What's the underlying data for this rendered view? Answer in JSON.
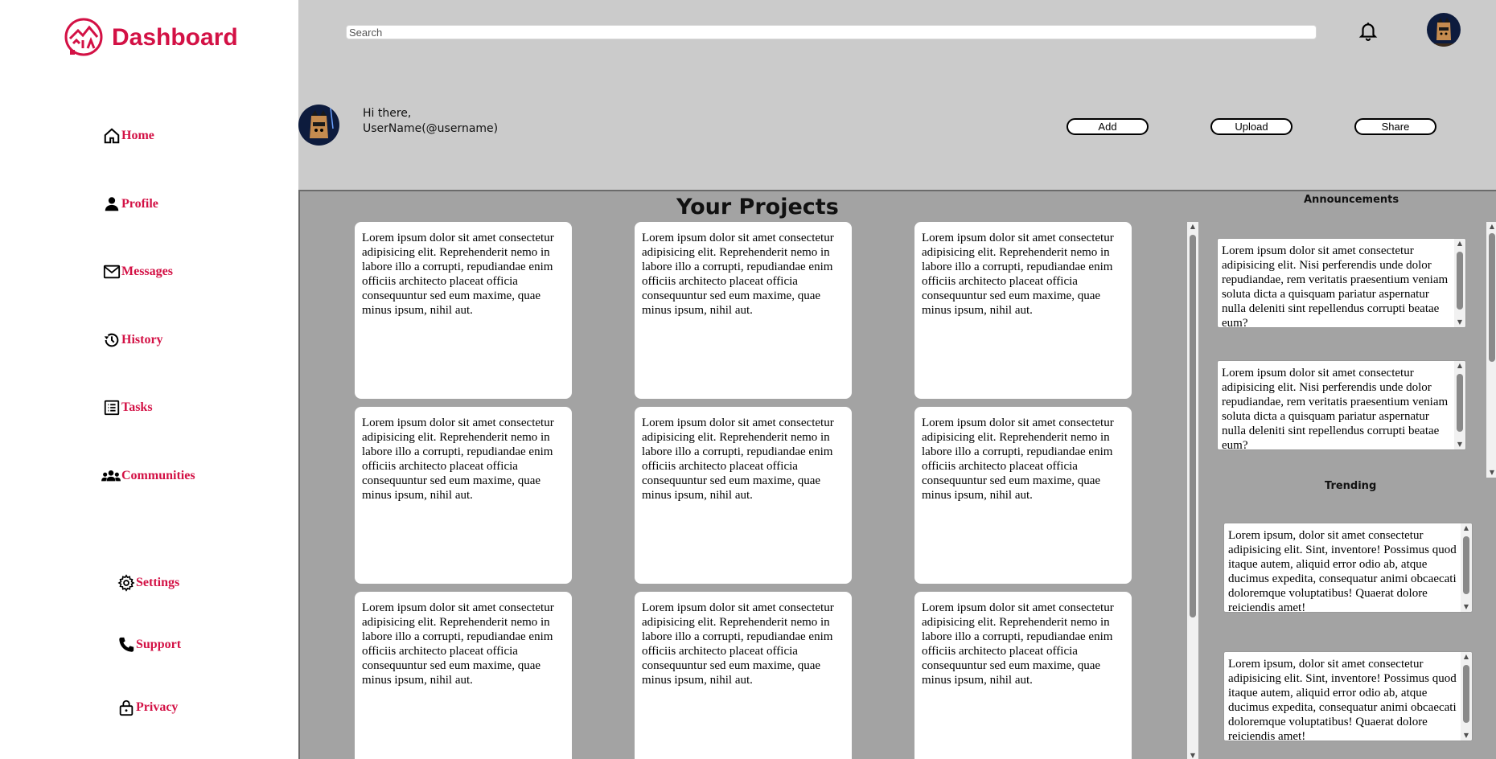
{
  "brand": {
    "title": "Dashboard",
    "color": "#d31145",
    "logo_icon": "aia-logo"
  },
  "sidebar": {
    "items": [
      {
        "label": "Home",
        "icon": "home-icon"
      },
      {
        "label": "Profile",
        "icon": "person-icon"
      },
      {
        "label": "Messages",
        "icon": "mail-icon"
      },
      {
        "label": "History",
        "icon": "history-icon"
      },
      {
        "label": "Tasks",
        "icon": "tasks-icon"
      },
      {
        "label": "Communities",
        "icon": "group-icon"
      }
    ],
    "bottom_items": [
      {
        "label": "Settings",
        "icon": "gear-icon"
      },
      {
        "label": "Support",
        "icon": "phone-icon"
      },
      {
        "label": "Privacy",
        "icon": "lock-icon"
      }
    ]
  },
  "header": {
    "search_placeholder": "Search",
    "greeting": "Hi there,",
    "username": "UserName(@username)",
    "buttons": {
      "add": "Add",
      "upload": "Upload",
      "share": "Share"
    }
  },
  "projects": {
    "title": "Your Projects",
    "cards": [
      "Lorem ipsum dolor sit amet consectetur adipisicing elit. Reprehenderit nemo in labore illo a corrupti, repudiandae enim officiis architecto placeat officia consequuntur sed eum maxime, quae minus ipsum, nihil aut.",
      "Lorem ipsum dolor sit amet consectetur adipisicing elit. Reprehenderit nemo in labore illo a corrupti, repudiandae enim officiis architecto placeat officia consequuntur sed eum maxime, quae minus ipsum, nihil aut.",
      "Lorem ipsum dolor sit amet consectetur adipisicing elit. Reprehenderit nemo in labore illo a corrupti, repudiandae enim officiis architecto placeat officia consequuntur sed eum maxime, quae minus ipsum, nihil aut.",
      "Lorem ipsum dolor sit amet consectetur adipisicing elit. Reprehenderit nemo in labore illo a corrupti, repudiandae enim officiis architecto placeat officia consequuntur sed eum maxime, quae minus ipsum, nihil aut.",
      "Lorem ipsum dolor sit amet consectetur adipisicing elit. Reprehenderit nemo in labore illo a corrupti, repudiandae enim officiis architecto placeat officia consequuntur sed eum maxime, quae minus ipsum, nihil aut.",
      "Lorem ipsum dolor sit amet consectetur adipisicing elit. Reprehenderit nemo in labore illo a corrupti, repudiandae enim officiis architecto placeat officia consequuntur sed eum maxime, quae minus ipsum, nihil aut.",
      "Lorem ipsum dolor sit amet consectetur adipisicing elit. Reprehenderit nemo in labore illo a corrupti, repudiandae enim officiis architecto placeat officia consequuntur sed eum maxime, quae minus ipsum, nihil aut.",
      "Lorem ipsum dolor sit amet consectetur adipisicing elit. Reprehenderit nemo in labore illo a corrupti, repudiandae enim officiis architecto placeat officia consequuntur sed eum maxime, quae minus ipsum, nihil aut.",
      "Lorem ipsum dolor sit amet consectetur adipisicing elit. Reprehenderit nemo in labore illo a corrupti, repudiandae enim officiis architecto placeat officia consequuntur sed eum maxime, quae minus ipsum, nihil aut."
    ]
  },
  "announcements": {
    "title": "Announcements",
    "items": [
      "Lorem ipsum dolor sit amet consectetur adipisicing elit. Nisi perferendis unde dolor repudiandae, rem veritatis praesentium veniam soluta dicta a quisquam pariatur aspernatur nulla deleniti sint repellendus corrupti beatae eum?",
      "Lorem ipsum dolor sit amet consectetur adipisicing elit. Nisi perferendis unde dolor repudiandae, rem veritatis praesentium veniam soluta dicta a quisquam pariatur aspernatur nulla deleniti sint repellendus corrupti beatae eum?"
    ]
  },
  "trending": {
    "title": "Trending",
    "items": [
      "Lorem ipsum, dolor sit amet consectetur adipisicing elit. Sint, inventore! Possimus quod itaque autem, aliquid error odio ab, atque ducimus expedita, consequatur animi obcaecati doloremque voluptatibus! Quaerat dolore reiciendis amet!",
      "Lorem ipsum, dolor sit amet consectetur adipisicing elit. Sint, inventore! Possimus quod itaque autem, aliquid error odio ab, atque ducimus expedita, consequatur animi obcaecati doloremque voluptatibus! Quaerat dolore reiciendis amet!"
    ]
  }
}
